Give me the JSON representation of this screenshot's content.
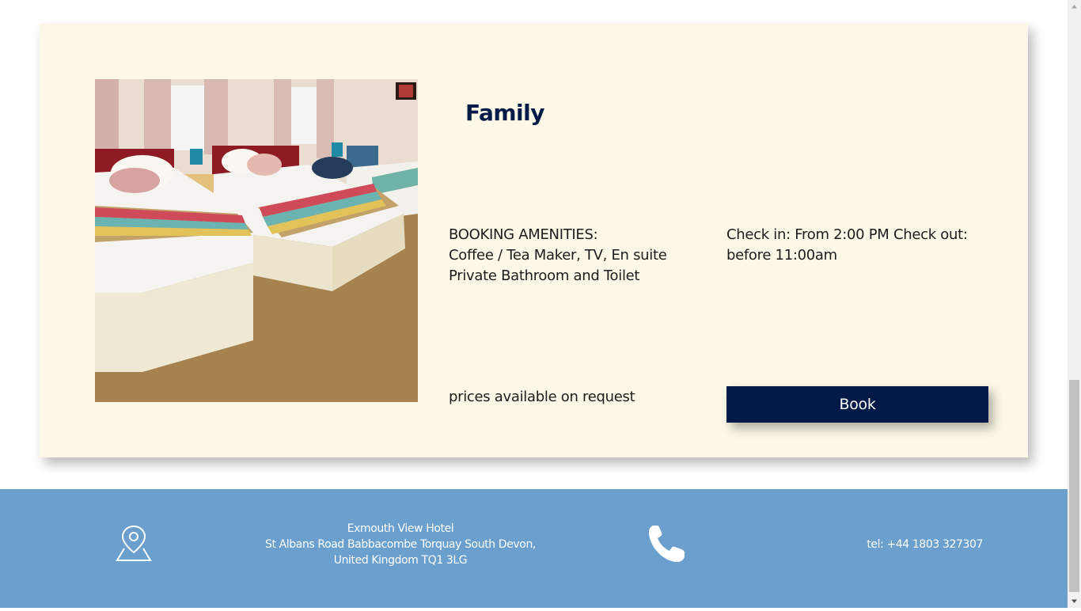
{
  "room": {
    "title": "Family",
    "photo_alt": "Family room with three beds",
    "amenities_heading": "BOOKING AMENITIES:",
    "amenities_text": "Coffee / Tea Maker, TV, En suite Private Bathroom and Toilet",
    "checkin_text": "Check in: From 2:00 PM Check out: before 11:00am",
    "prices_text": "prices available on request",
    "book_label": "Book"
  },
  "footer": {
    "hotel_name": "Exmouth View Hotel",
    "address_line1": "St Albans Road Babbacombe Torquay South Devon,",
    "address_line2": "United Kingdom TQ1 3LG",
    "phone": "tel: +44 1803 327307",
    "location_icon": "map-pin-icon",
    "phone_icon": "phone-icon"
  },
  "colors": {
    "card_background": "#fcf7e6",
    "title": "#021a47",
    "book_button": "#021a47",
    "footer_background": "#6b9fcd"
  }
}
